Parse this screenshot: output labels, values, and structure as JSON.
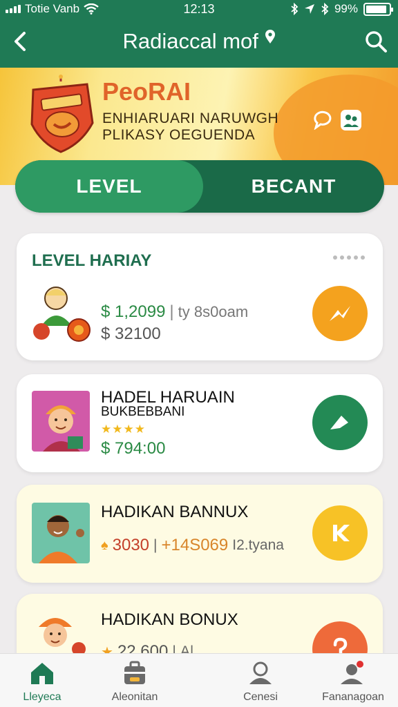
{
  "status_bar": {
    "carrier": "Totie Vanb",
    "time": "12:13",
    "battery": "99%",
    "battery_level": 0.9
  },
  "header": {
    "title": "Radiaccal mof",
    "back_icon": "back-chevron-icon",
    "search_icon": "search-icon"
  },
  "banner": {
    "title": "PeoRAI",
    "subtitle_line1": "ENHIARUARI NARUWGH",
    "subtitle_line2": "PLIKASY OEGUENDA"
  },
  "tabs": [
    {
      "label": "LEVEL",
      "active": true
    },
    {
      "label": "BECANT",
      "active": false
    }
  ],
  "cards": [
    {
      "heading": "LEVEL HARIAY",
      "price_primary": "$ 1,2099",
      "separator": "|",
      "note": "ty 8s0oam",
      "price_secondary": "$ 32100",
      "action_color": "#f4a21e"
    },
    {
      "title": "HADEL HARUAIN",
      "subtitle": "BUKBEBBANI",
      "rating": "★★★★",
      "price": "$ 794:00",
      "action_color": "#238a55"
    },
    {
      "title": "HADIKAN BANNUX",
      "value": "3030",
      "separator": "|",
      "plus_value": "+14S069",
      "grey_text": "I2.tyana",
      "action_color": "#f7c226"
    },
    {
      "title": "HADIKAN BONUX",
      "value": "22,600",
      "separator": "|",
      "grey_text": "A|",
      "action_color": "#ee6a3a"
    }
  ],
  "bottom_nav": [
    {
      "label": "Lleyeca",
      "icon": "home-icon",
      "active": true
    },
    {
      "label": "Aleonitan",
      "icon": "briefcase-icon",
      "active": false
    },
    {
      "label": "Cenesi",
      "icon": "profile-icon",
      "active": false
    },
    {
      "label": "Fananagoan",
      "icon": "user-notification-icon",
      "active": false
    }
  ]
}
